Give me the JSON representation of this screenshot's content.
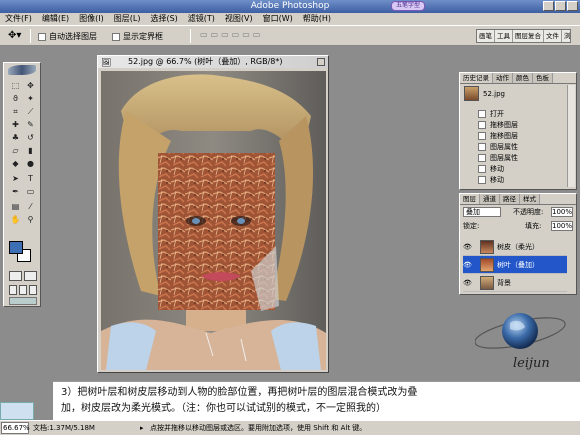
{
  "app": {
    "title": "Adobe Photoshop",
    "sticker": "五笔字型"
  },
  "menu": [
    "文件(F)",
    "编辑(E)",
    "图像(I)",
    "图层(L)",
    "选择(S)",
    "滤镜(T)",
    "视图(V)",
    "窗口(W)",
    "帮助(H)"
  ],
  "options": {
    "auto_select_layer": "自动选择图层",
    "show_bounding_box": "显示定界框",
    "palette_tabs": [
      "画笔",
      "工具",
      "图层复合",
      "文件",
      "浏"
    ]
  },
  "document": {
    "title": "52.jpg @ 66.7% (树叶（叠加）, RGB/8*)"
  },
  "history": {
    "tabs": [
      "历史记录",
      "动作",
      "颜色",
      "色板"
    ],
    "snapshot": "52.jpg",
    "items": [
      "打开",
      "拖移图层",
      "拖移图层",
      "图层属性",
      "图层属性",
      "移动",
      "移动"
    ]
  },
  "layers": {
    "tabs": [
      "图层",
      "通道",
      "路径",
      "样式"
    ],
    "blend_mode": "叠加",
    "opacity_label": "不透明度:",
    "opacity_value": "100%",
    "lock_label": "锁定:",
    "fill_label": "填充:",
    "fill_value": "100%",
    "rows": [
      {
        "name": "树皮（柔光）",
        "eye": "👁"
      },
      {
        "name": "树叶（叠加）",
        "eye": "👁"
      },
      {
        "name": "背景",
        "eye": "👁"
      }
    ]
  },
  "logo": {
    "text": "leijun"
  },
  "caption": {
    "line1": "3）把树叶层和树皮层移动到人物的脸部位置，再把树叶层的图层混合模式改为叠",
    "line2": "加，树皮层改为柔光模式。（注：你也可以试试别的模式，不一定照我的）"
  },
  "status": {
    "zoom": "66.67%",
    "doc": "文档:1.37M/5.18M",
    "arrow": "▸",
    "hint": "点按并拖移以移动图层或选区。要用附加选项，使用 Shift 和 Alt 键。"
  }
}
